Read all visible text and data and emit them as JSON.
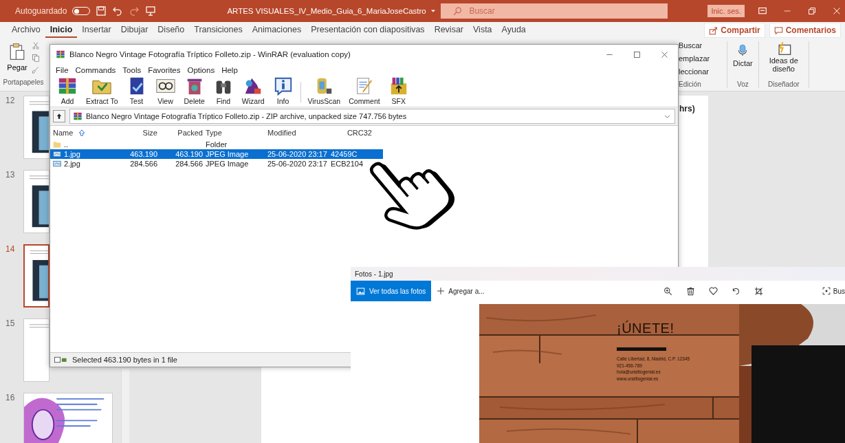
{
  "powerpoint": {
    "autosave_label": "Autoguardado",
    "autosave_on": false,
    "doc_title": "ARTES VISUALES_IV_Medio_Guia_6_MariaJoseCastro",
    "search_placeholder": "Buscar",
    "sign_in": "Inic. ses.",
    "tabs": [
      {
        "label": "Archivo",
        "selected": false
      },
      {
        "label": "Inicio",
        "selected": true
      },
      {
        "label": "Insertar",
        "selected": false
      },
      {
        "label": "Dibujar",
        "selected": false
      },
      {
        "label": "Diseño",
        "selected": false
      },
      {
        "label": "Transiciones",
        "selected": false
      },
      {
        "label": "Animaciones",
        "selected": false
      },
      {
        "label": "Presentación con diapositivas",
        "selected": false
      },
      {
        "label": "Revisar",
        "selected": false
      },
      {
        "label": "Vista",
        "selected": false
      },
      {
        "label": "Ayuda",
        "selected": false
      }
    ],
    "share": "Compartir",
    "comments": "Comentarios",
    "clipboard": {
      "paste": "Pegar",
      "group": "Portapapeles"
    },
    "editing": {
      "items": [
        "Buscar",
        "emplazar",
        "leccionar"
      ],
      "group": "Edición"
    },
    "voice": {
      "dictate": "Dictar",
      "group": "Voz"
    },
    "designer": {
      "ideas": "Ideas de diseño",
      "group": "Diseñador"
    },
    "slides": [
      {
        "number": "12",
        "selected": false
      },
      {
        "number": "13",
        "selected": false
      },
      {
        "number": "14",
        "selected": true
      },
      {
        "number": "15",
        "selected": false
      },
      {
        "number": "16",
        "selected": false
      }
    ],
    "slide_text": "hrs)"
  },
  "winrar": {
    "title": "Blanco Negro Vintage Fotografía Tríptico Folleto.zip - WinRAR (evaluation copy)",
    "menu": [
      "File",
      "Commands",
      "Tools",
      "Favorites",
      "Options",
      "Help"
    ],
    "toolbar": [
      "Add",
      "Extract To",
      "Test",
      "View",
      "Delete",
      "Find",
      "Wizard",
      "Info",
      "VirusScan",
      "Comment",
      "SFX"
    ],
    "path": "Blanco Negro Vintage Fotografía Tríptico Folleto.zip - ZIP archive, unpacked size 747.756 bytes",
    "columns": [
      "Name",
      "Size",
      "Packed",
      "Type",
      "Modified",
      "CRC32"
    ],
    "rows": [
      {
        "kind": "folder",
        "name": "..",
        "size": "",
        "packed": "",
        "type": "Folder",
        "modified": "",
        "crc": "",
        "selected": false
      },
      {
        "kind": "file",
        "name": "1.jpg",
        "size": "463.190",
        "packed": "463.190",
        "type": "JPEG Image",
        "modified": "25-06-2020 23:17",
        "crc": "42459C",
        "selected": true
      },
      {
        "kind": "file",
        "name": "2.jpg",
        "size": "284.566",
        "packed": "284.566",
        "type": "JPEG Image",
        "modified": "25-06-2020 23:17",
        "crc": "ECB2104",
        "selected": false
      }
    ],
    "status": "Selected 463.190 bytes in 1 file"
  },
  "photos": {
    "title": "Fotos - 1.jpg",
    "view_all": "Ver todas las fotos",
    "add_to": "Agregar a...",
    "search": "Bus",
    "flyer": {
      "heading": "¡ÚNETE!",
      "lines": [
        "Calle Libertad, 8, Madrid, C.P. 12345",
        "921-456-789",
        "hola@unsitiogenial.es",
        "www.unsitiogenial.es"
      ]
    }
  }
}
